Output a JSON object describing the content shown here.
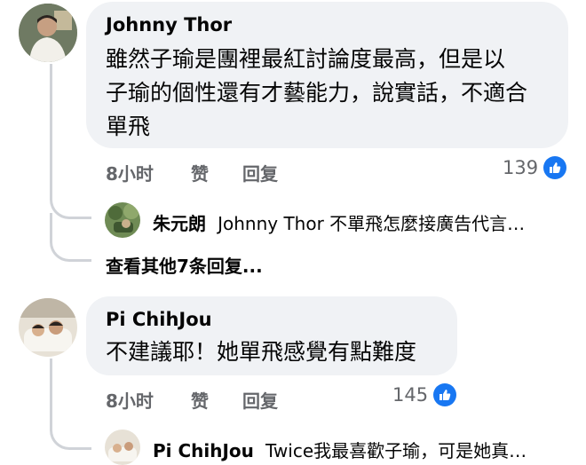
{
  "comments": [
    {
      "author": "Johnny Thor",
      "text_line1": "雖然子瑜是團裡最紅討論度最高，但是以",
      "text_line2": "子瑜的個性還有才藝能力，說實話，不適合",
      "text_line3": "單飛",
      "time": "8小时",
      "like_label": "赞",
      "reply_label": "回复",
      "likes": "139",
      "reply_preview": {
        "author": "朱元朗",
        "text": "Johnny Thor 不單飛怎麼接廣告代言…"
      },
      "more_replies": "查看其他7条回复..."
    },
    {
      "author": "Pi ChihJou",
      "text_line1": "不建議耶！她單飛感覺有點難度",
      "time": "8小时",
      "like_label": "赞",
      "reply_label": "回复",
      "likes": "145",
      "reply_preview": {
        "author": "Pi ChihJou",
        "text": "Twice我最喜歡子瑜，可是她真…"
      }
    }
  ],
  "colors": {
    "bubble": "#f0f2f5",
    "like_blue": "#1877f2",
    "secondary_text": "#65676b"
  },
  "icons": [
    "thumbs-up-icon"
  ]
}
